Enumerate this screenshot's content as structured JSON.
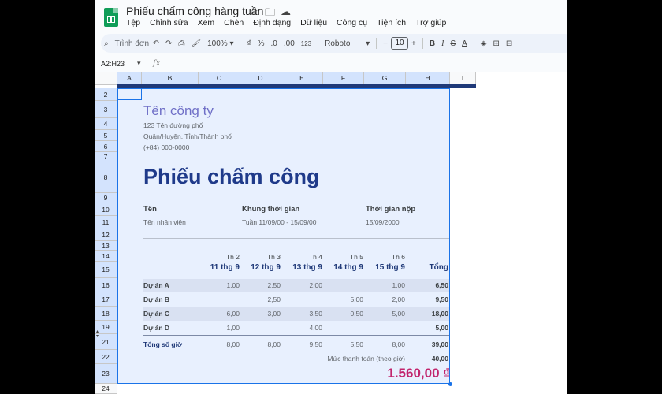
{
  "app": {
    "doc_title": "Phiếu chấm công hàng tuần",
    "menu": [
      "Tệp",
      "Chỉnh sửa",
      "Xem",
      "Chèn",
      "Định dạng",
      "Dữ liệu",
      "Công cụ",
      "Tiện ích",
      "Trợ giúp"
    ]
  },
  "toolbar": {
    "search_placeholder": "Trình đơn",
    "zoom": "100%",
    "currency": "₫",
    "percent": "%",
    "dec_decrease": ".0",
    "dec_increase": ".00",
    "number_format": "123",
    "font": "Roboto",
    "font_size": "10",
    "bold": "B",
    "italic": "I",
    "strike": "S",
    "text_color": "A"
  },
  "formula_bar": {
    "name_box": "A2:H23",
    "fx": "fx"
  },
  "columns": [
    "A",
    "B",
    "C",
    "D",
    "E",
    "F",
    "G",
    "H",
    "I"
  ],
  "rows": [
    "2",
    "3",
    "4",
    "5",
    "6",
    "7",
    "8",
    "9",
    "10",
    "11",
    "12",
    "13",
    "14",
    "15",
    "16",
    "17",
    "18",
    "19",
    "21",
    "22",
    "23",
    "24"
  ],
  "sheet": {
    "company": "Tên công ty",
    "address1": "123 Tên đường phố",
    "address2": "Quận/Huyện, Tỉnh/Thành phố",
    "phone": "(+84) 000-0000",
    "heading": "Phiếu chấm công",
    "name_label": "Tên",
    "name_value": "Tên nhân viên",
    "period_label": "Khung thời gian",
    "period_value": "Tuần 11/09/00 - 15/09/00",
    "submit_label": "Thời gian nộp",
    "submit_value": "15/09/2000",
    "days": [
      {
        "name": "Th 2",
        "date": "11 thg 9"
      },
      {
        "name": "Th 3",
        "date": "12 thg 9"
      },
      {
        "name": "Th 4",
        "date": "13 thg 9"
      },
      {
        "name": "Th 5",
        "date": "14 thg 9"
      },
      {
        "name": "Th 6",
        "date": "15 thg 9"
      }
    ],
    "total_header": "Tổng",
    "projects": [
      {
        "name": "Dự án A",
        "values": [
          "1,00",
          "2,50",
          "2,00",
          "",
          "1,00"
        ],
        "total": "6,50"
      },
      {
        "name": "Dự án B",
        "values": [
          "",
          "2,50",
          "",
          "5,00",
          "2,00"
        ],
        "total": "9,50"
      },
      {
        "name": "Dự án C",
        "values": [
          "6,00",
          "3,00",
          "3,50",
          "0,50",
          "5,00"
        ],
        "total": "18,00"
      },
      {
        "name": "Dự án D",
        "values": [
          "1,00",
          "",
          "4,00",
          "",
          ""
        ],
        "total": "5,00"
      }
    ],
    "total_hours_label": "Tổng số giờ",
    "total_hours": [
      "8,00",
      "8,00",
      "9,50",
      "5,50",
      "8,00"
    ],
    "total_hours_sum": "39,00",
    "rate_label": "Mức thanh toán (theo giờ)",
    "rate_value": "40,00",
    "pay_total": "1.560,00 ₫"
  }
}
